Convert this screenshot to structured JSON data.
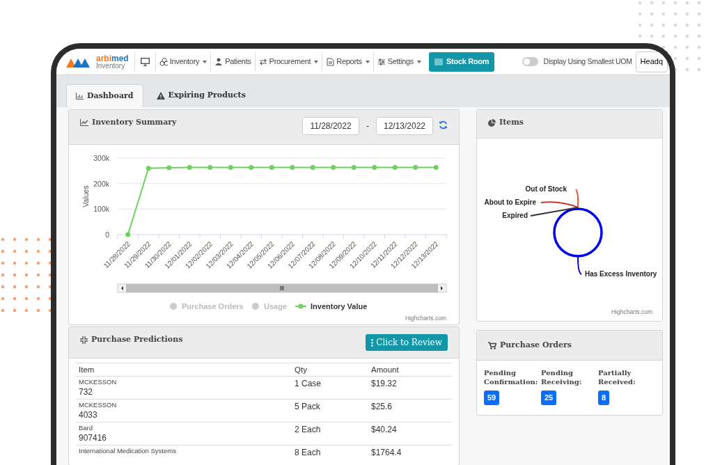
{
  "navbar": {
    "logo": {
      "brand_first": "arbi",
      "brand_second": "med",
      "subtitle": "Inventory"
    },
    "items": [
      {
        "label": "Inventory",
        "dropdown": true
      },
      {
        "label": "Patients",
        "dropdown": false
      },
      {
        "label": "Procurement",
        "dropdown": true
      },
      {
        "label": "Reports",
        "dropdown": true
      },
      {
        "label": "Settings",
        "dropdown": true
      }
    ],
    "stock_room_button": "Stock Room",
    "uom_toggle": {
      "label": "Display Using Smallest UOM",
      "on": false
    },
    "location_button": "Headq"
  },
  "tabs": [
    {
      "label": "Dashboard",
      "selected": true
    },
    {
      "label": "Expiring Products",
      "selected": false
    }
  ],
  "inventory_summary": {
    "title": "Inventory Summary",
    "date_from": "11/28/2022",
    "date_separator": "-",
    "date_to": "12/13/2022",
    "hidden_series": [
      {
        "label": "Purchase Orders"
      },
      {
        "label": "Usage"
      }
    ],
    "credit": "Highcharts.com",
    "chart_data": {
      "type": "line",
      "ylabel": "Values",
      "categories": [
        "11/28/2022",
        "11/29/2022",
        "11/30/2022",
        "12/01/2022",
        "12/02/2022",
        "12/03/2022",
        "12/04/2022",
        "12/05/2022",
        "12/06/2022",
        "12/07/2022",
        "12/08/2022",
        "12/09/2022",
        "12/10/2022",
        "12/11/2022",
        "12/12/2022",
        "12/13/2022"
      ],
      "ylim": [
        0,
        300000
      ],
      "yticks": [
        {
          "value": 0,
          "label": "0"
        },
        {
          "value": 100000,
          "label": "100k"
        },
        {
          "value": 200000,
          "label": "200k"
        },
        {
          "value": 300000,
          "label": "300k"
        }
      ],
      "series": [
        {
          "name": "Inventory Value",
          "color": "#6cd35a",
          "marker": true,
          "values": [
            0,
            260000,
            262000,
            263000,
            263000,
            263000,
            263000,
            263000,
            263000,
            263000,
            263000,
            263000,
            263000,
            263000,
            263000,
            263000
          ]
        }
      ]
    }
  },
  "items_panel": {
    "title": "Items",
    "credit": "Highcharts.com",
    "labels": [
      {
        "text": "Out of Stock",
        "color": "#e8503a"
      },
      {
        "text": "About to Expire",
        "color": "#c0392b"
      },
      {
        "text": "Expired",
        "color": "#333333"
      },
      {
        "text": "Has Excess Inventory",
        "color": "#0000ee"
      }
    ]
  },
  "purchase_predictions": {
    "title": "Purchase Predictions",
    "review_button": "Click to Review",
    "columns": [
      "Item",
      "Qty",
      "Amount"
    ],
    "rows": [
      {
        "vendor": "MCKESSON",
        "code": "732",
        "qty": "1 Case",
        "amount": "$19.32"
      },
      {
        "vendor": "MCKESSON",
        "code": "4033",
        "qty": "5 Pack",
        "amount": "$25.6"
      },
      {
        "vendor": "Bard",
        "code": "907416",
        "qty": "2 Each",
        "amount": "$40.24"
      },
      {
        "vendor": "International Medication Systems",
        "qty": "8 Each",
        "amount": "$1764.4"
      }
    ]
  },
  "purchase_orders": {
    "title": "Purchase Orders",
    "stats": [
      {
        "label": "Pending Confirmation:",
        "count": "59"
      },
      {
        "label": "Pending Receiving:",
        "count": "25"
      },
      {
        "label": "Partially Received:",
        "count": "8"
      }
    ]
  }
}
